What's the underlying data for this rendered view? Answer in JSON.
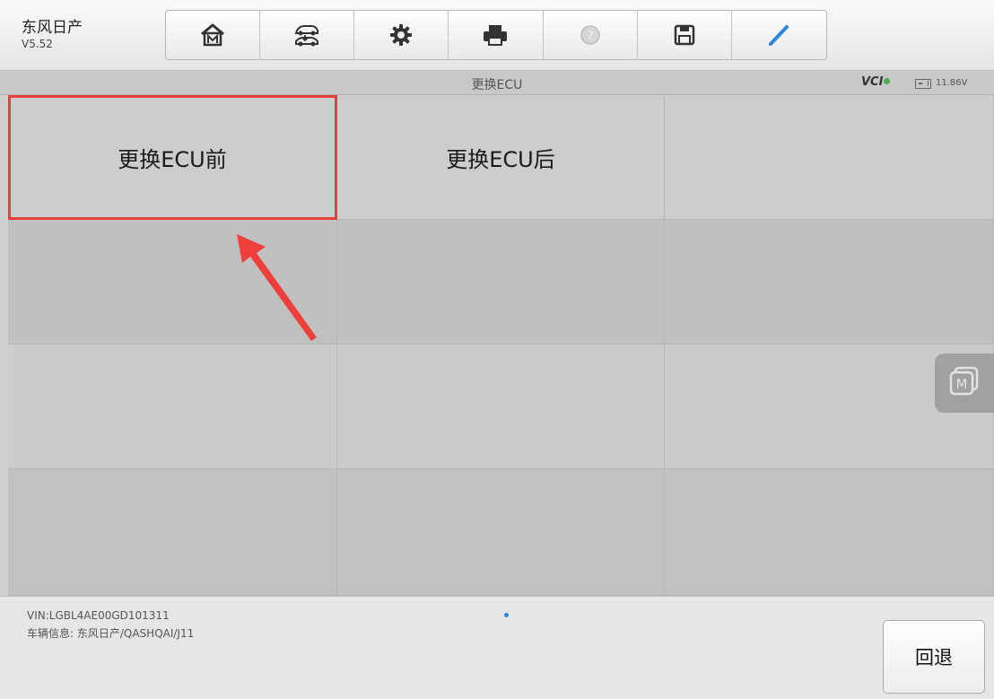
{
  "header": {
    "app_title": "东风日产",
    "version": "V5.52",
    "toolbar": [
      {
        "icon": "home-m-icon"
      },
      {
        "icon": "vehicle-swap-icon"
      },
      {
        "icon": "gear-icon"
      },
      {
        "icon": "printer-icon"
      },
      {
        "icon": "help-icon"
      },
      {
        "icon": "save-icon"
      },
      {
        "icon": "pen-icon"
      }
    ]
  },
  "subbar": {
    "title": "更换ECU",
    "vci_label": "VCI",
    "voltage": "11.86V"
  },
  "grid": {
    "items": [
      "更换ECU前",
      "更换ECU后",
      "",
      "",
      "",
      "",
      "",
      "",
      "",
      "",
      "",
      ""
    ],
    "selected_index": 0
  },
  "footer": {
    "vin": "VIN:LGBL4AE00GD101311",
    "vehicle_info": "车辆信息: 东风日产/QASHQAI/J11",
    "back_label": "回退"
  },
  "colors": {
    "highlight": "#e8403c",
    "accent_blue": "#2f86d8"
  }
}
